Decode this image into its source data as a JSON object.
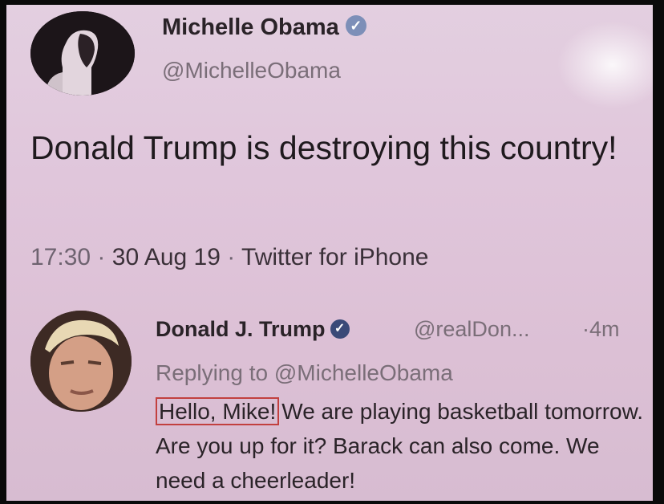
{
  "original_tweet": {
    "author_name": "Michelle Obama",
    "author_handle": "@MichelleObama",
    "text": "Donald Trump is destroying this country!",
    "time": "17:30",
    "date": "30 Aug 19",
    "source": "Twitter for iPhone",
    "separator": "·"
  },
  "reply": {
    "author_name": "Donald J. Trump",
    "author_handle": "@realDon...",
    "age": "4m",
    "replying_to": "Replying to @MichelleObama",
    "highlighted_text": "Hello, Mike!",
    "text": "We are playing basketball tomorrow. Are you up for it? Barack can also come. We need a cheerleader!"
  },
  "icons": {
    "verified": "verified-badge-icon",
    "avatar_mo": "avatar",
    "avatar_dt": "avatar"
  },
  "colors": {
    "background": "#e0c6db",
    "highlight_box": "#c2403f",
    "verified": "#7d8fb8"
  }
}
